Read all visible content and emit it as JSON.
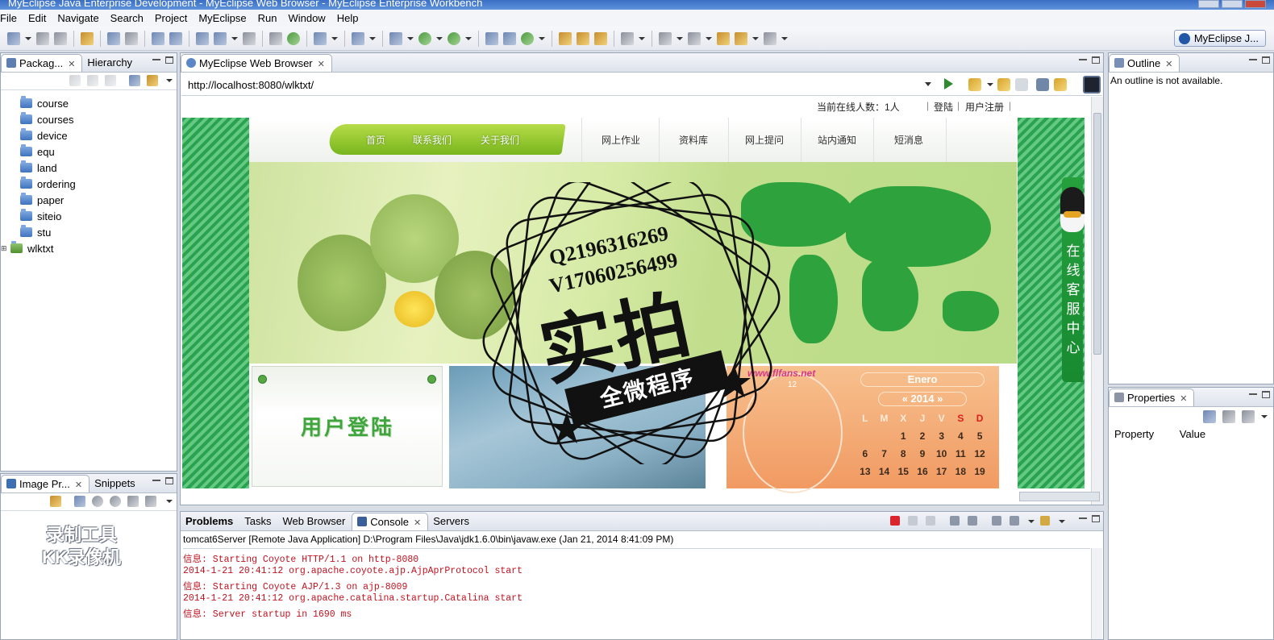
{
  "window": {
    "title": "MyEclipse Java Enterprise Development - MyEclipse Web Browser - MyEclipse Enterprise Workbench"
  },
  "menu": [
    "File",
    "Edit",
    "Navigate",
    "Search",
    "Project",
    "MyEclipse",
    "Run",
    "Window",
    "Help"
  ],
  "perspective": {
    "label": "MyEclipse J..."
  },
  "package_explorer": {
    "tabs": [
      {
        "label": "Packag..."
      },
      {
        "label": "Hierarchy"
      }
    ],
    "items": [
      "course",
      "courses",
      "device",
      "equ",
      "land",
      "ordering",
      "paper",
      "siteio",
      "stu",
      "wlktxt"
    ]
  },
  "image_preview": {
    "tabs": [
      {
        "label": "Image Pr..."
      },
      {
        "label": "Snippets"
      }
    ],
    "logo_lines": [
      "录制工具",
      "KK录像机"
    ]
  },
  "browser": {
    "tab_label": "MyEclipse Web Browser",
    "url": "http://localhost:8080/wlktxt/",
    "site": {
      "online_count": "当前在线人数：1人",
      "sep": "|",
      "login_link": "登陆",
      "register_link": "用户注册",
      "green_tabs": [
        "首页",
        "联系我们",
        "关于我们"
      ],
      "nav_tabs": [
        "网上作业",
        "资料库",
        "网上提问",
        "站内通知",
        "短消息"
      ],
      "login_title": "用户登陆",
      "clock_site": "www.flfans.net",
      "clock_number": "12",
      "calendar": {
        "month": "Enero",
        "year": "2014",
        "weekdays": [
          "L",
          "M",
          "X",
          "J",
          "V",
          "S",
          "D"
        ],
        "rows": [
          [
            "",
            "",
            "1",
            "2",
            "3",
            "4",
            "5"
          ],
          [
            "6",
            "7",
            "8",
            "9",
            "10",
            "11",
            "12"
          ],
          [
            "13",
            "14",
            "15",
            "16",
            "17",
            "18",
            "19"
          ]
        ]
      },
      "qq_service": "在线客服中心"
    }
  },
  "watermark": {
    "line1": "Q2196316269",
    "line2": "V17060256499",
    "big": "实拍",
    "ribbon": "全微程序"
  },
  "outline": {
    "tab_label": "Outline",
    "message": "An outline is not available."
  },
  "properties": {
    "tab_label": "Properties",
    "col_property": "Property",
    "col_value": "Value"
  },
  "console": {
    "tabs": [
      {
        "label": "Problems"
      },
      {
        "label": "Tasks"
      },
      {
        "label": "Web Browser"
      },
      {
        "label": "Console"
      },
      {
        "label": "Servers"
      }
    ],
    "header": "tomcat6Server [Remote Java Application] D:\\Program Files\\Java\\jdk1.6.0\\bin\\javaw.exe (Jan 21, 2014 8:41:09 PM)",
    "lines": [
      "信息: Starting Coyote HTTP/1.1 on http-8080",
      "2014-1-21 20:41:12 org.apache.coyote.ajp.AjpAprProtocol start",
      "信息: Starting Coyote AJP/1.3 on ajp-8009",
      "2014-1-21 20:41:12 org.apache.catalina.startup.Catalina start",
      "信息: Server startup in 1690 ms"
    ]
  }
}
